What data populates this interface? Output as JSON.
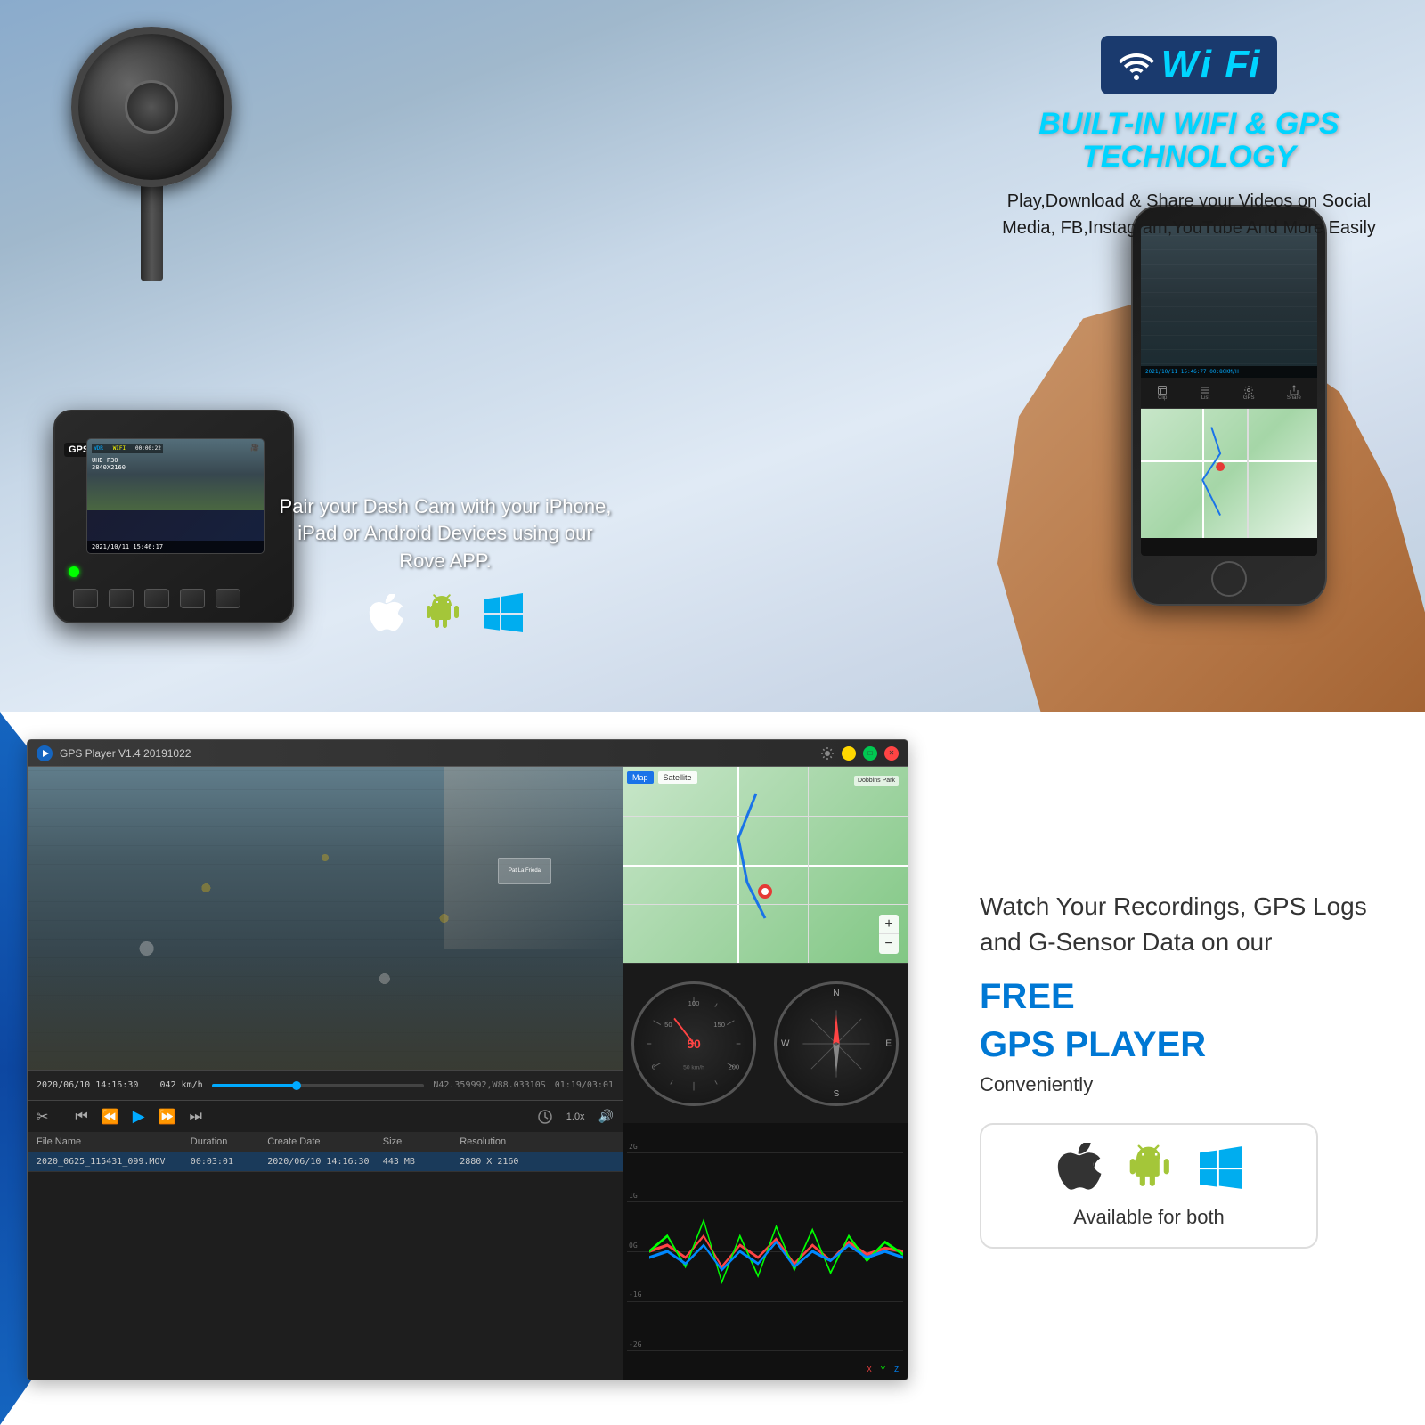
{
  "page": {
    "dimensions": "1600x1600"
  },
  "top_section": {
    "wifi_badge": {
      "wifi_label": "Wi Fi",
      "symbol": "📶"
    },
    "wifi_title": "BUILT-IN WIFI & GPS TECHNOLOGY",
    "wifi_desc": "Play,Download & Share your Videos on Social Media, FB,Instagram,YouTube And More Easily",
    "pair_text": "Pair your Dash Cam with your iPhone, iPad or Android Devices using our Rove APP.",
    "app_icons": {
      "apple": "🍎",
      "android": "🤖",
      "windows": "⊞"
    },
    "dashcam": {
      "gps_label": "GPS",
      "screen_text": "UHD P30\n3840X2160",
      "timestamp": "2021/10/11  15:46:17",
      "wdr_label": "WDR"
    },
    "phone": {
      "timestamp": "2021/10/11  15:46:77 00:80KM/H"
    }
  },
  "bottom_section": {
    "player": {
      "title": "GPS Player V1.4 20191022",
      "controls": {
        "timestamp": "2020/06/10  14:16:30",
        "speed": "042 km/h",
        "coords": "N42.359992,W88.03310S",
        "duration": "01:19/03:01",
        "playback_speed": "1.0x"
      },
      "file_list": {
        "headers": [
          "File Name",
          "Duration",
          "Create Date",
          "Size",
          "Resolution"
        ],
        "rows": [
          {
            "name": "2020_0625_115431_099.MOV",
            "duration": "00:03:01",
            "create_date": "2020/06/10  14:16:30",
            "size": "443 MB",
            "resolution": "2880 X 2160"
          }
        ]
      },
      "map": {
        "tabs": [
          "Map",
          "Satellite"
        ]
      },
      "gsensor": {
        "labels": [
          "2G",
          "1G",
          "0G",
          "-1G",
          "-2G"
        ],
        "series": [
          "X",
          "Y",
          "Z"
        ]
      }
    },
    "right_panel": {
      "title": "Watch Your Recordings, GPS Logs and G-Sensor Data on our",
      "accent": "FREE\nGPS PLAYER",
      "sub": "",
      "conveniently": "Conveniently",
      "platform_label": "Available for both",
      "platforms": [
        "Apple",
        "Android",
        "Windows"
      ]
    }
  }
}
